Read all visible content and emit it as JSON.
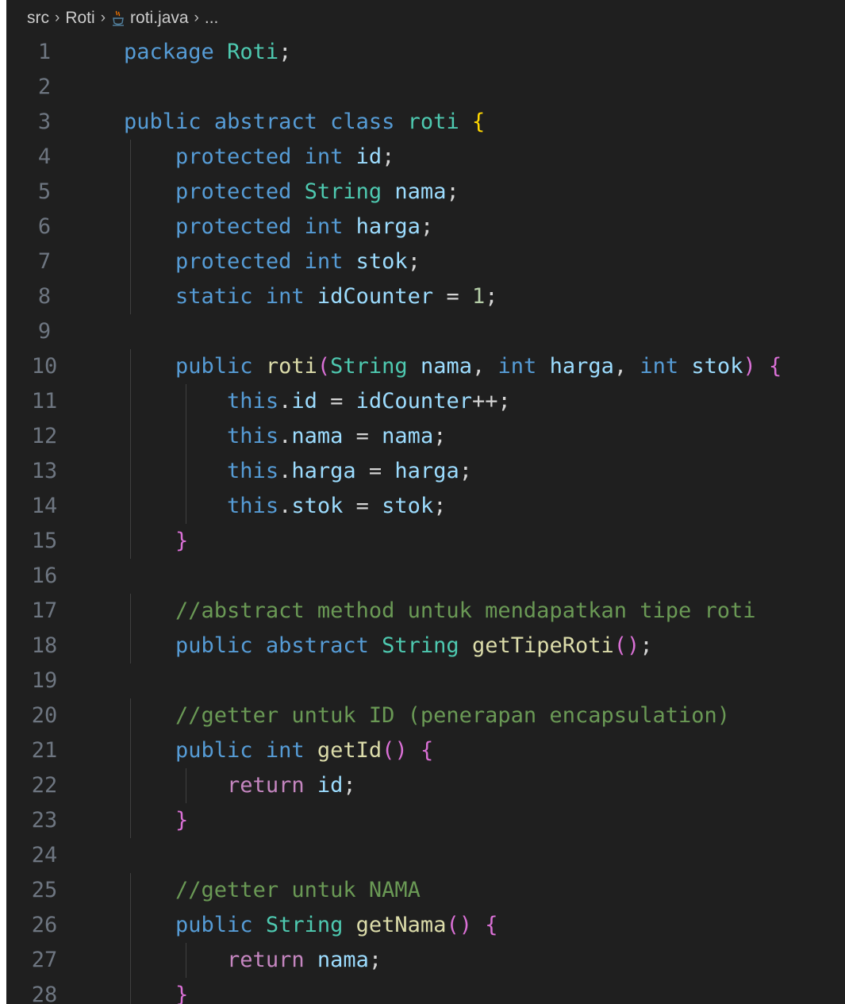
{
  "breadcrumb": {
    "items": [
      "src",
      "Roti",
      "roti.java",
      "..."
    ],
    "separator": "›",
    "file_icon": "java-cup-icon"
  },
  "theme": {
    "background": "#1f1f1f",
    "keyword": "#569cd6",
    "control": "#c586c0",
    "type": "#4ec9b0",
    "variable": "#9cdcfe",
    "function": "#dcdcaa",
    "number": "#b5cea8",
    "comment": "#6a9955"
  },
  "code": {
    "language": "java",
    "lines": [
      {
        "n": "1",
        "text": "package Roti;"
      },
      {
        "n": "2",
        "text": ""
      },
      {
        "n": "3",
        "text": "public abstract class roti {"
      },
      {
        "n": "4",
        "text": "    protected int id;"
      },
      {
        "n": "5",
        "text": "    protected String nama;"
      },
      {
        "n": "6",
        "text": "    protected int harga;"
      },
      {
        "n": "7",
        "text": "    protected int stok;"
      },
      {
        "n": "8",
        "text": "    static int idCounter = 1;"
      },
      {
        "n": "9",
        "text": ""
      },
      {
        "n": "10",
        "text": "    public roti(String nama, int harga, int stok) {"
      },
      {
        "n": "11",
        "text": "        this.id = idCounter++;"
      },
      {
        "n": "12",
        "text": "        this.nama = nama;"
      },
      {
        "n": "13",
        "text": "        this.harga = harga;"
      },
      {
        "n": "14",
        "text": "        this.stok = stok;"
      },
      {
        "n": "15",
        "text": "    }"
      },
      {
        "n": "16",
        "text": ""
      },
      {
        "n": "17",
        "text": "    //abstract method untuk mendapatkan tipe roti"
      },
      {
        "n": "18",
        "text": "    public abstract String getTipeRoti();"
      },
      {
        "n": "19",
        "text": ""
      },
      {
        "n": "20",
        "text": "    //getter untuk ID (penerapan encapsulation)"
      },
      {
        "n": "21",
        "text": "    public int getId() {"
      },
      {
        "n": "22",
        "text": "        return id;"
      },
      {
        "n": "23",
        "text": "    }"
      },
      {
        "n": "24",
        "text": ""
      },
      {
        "n": "25",
        "text": "    //getter untuk NAMA"
      },
      {
        "n": "26",
        "text": "    public String getNama() {"
      },
      {
        "n": "27",
        "text": "        return nama;"
      },
      {
        "n": "28",
        "text": "    }"
      }
    ]
  }
}
